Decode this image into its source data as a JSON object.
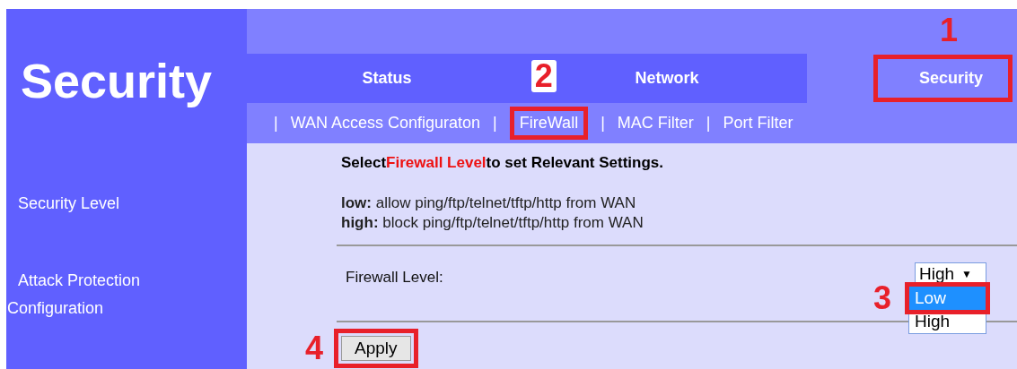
{
  "brand": {
    "title": "Security"
  },
  "sidebar": {
    "items": [
      {
        "label": "Security Level"
      },
      {
        "label": "Attack Protection Configuration"
      }
    ]
  },
  "tabs": [
    {
      "label": "Status",
      "selected": false
    },
    {
      "label": "Network",
      "selected": false
    },
    {
      "label": "Security",
      "selected": true,
      "callout": "1"
    }
  ],
  "subnav": [
    {
      "kind": "separator",
      "label": "|"
    },
    {
      "kind": "link",
      "label": "WAN Access Configuraton"
    },
    {
      "kind": "separator",
      "label": "|"
    },
    {
      "kind": "link",
      "label": "FireWall",
      "callout": "2"
    },
    {
      "kind": "separator",
      "label": "|"
    },
    {
      "kind": "link",
      "label": "MAC Filter"
    },
    {
      "kind": "separator",
      "label": "|"
    },
    {
      "kind": "link",
      "label": "Port Filter"
    }
  ],
  "content": {
    "heading": {
      "before": "Select",
      "emphasis": "Firewall Level",
      "after": "to set Relevant Settings."
    },
    "notes": [
      "**low:** allow ping/ftp/telnet/tftp/http from WAN",
      "**high:** block ping/ftp/telnet/tftp/http from WAN"
    ],
    "field": {
      "label": "Firewall Level:",
      "value": "High",
      "caret": "▼",
      "expanded": true,
      "options": [
        {
          "label": "Low",
          "highlighted": true,
          "callout": "3"
        },
        {
          "label": "High",
          "highlighted": false
        }
      ]
    },
    "apply_button": {
      "label": "Apply",
      "callout": "4"
    }
  }
}
